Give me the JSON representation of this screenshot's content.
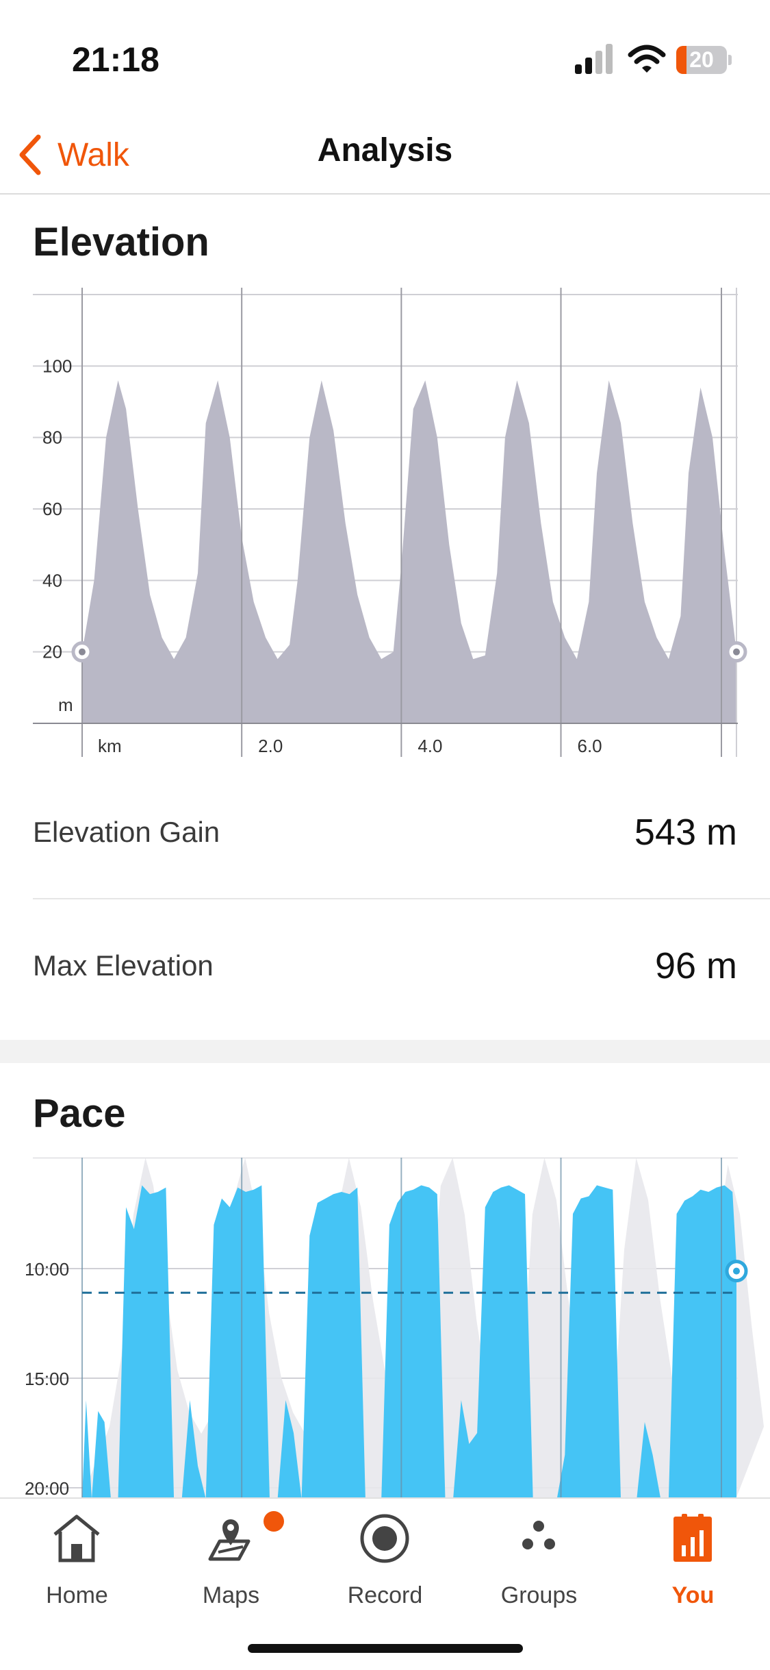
{
  "status_bar": {
    "time": "21:18",
    "battery_level": "20",
    "icons": [
      "cellular-signal-icon",
      "wifi-icon",
      "battery-icon"
    ],
    "accent": "#f0560a"
  },
  "nav": {
    "back_label": "Walk",
    "title": "Analysis"
  },
  "elevation": {
    "title": "Elevation",
    "gain_label": "Elevation Gain",
    "gain_value": "543 m",
    "max_label": "Max Elevation",
    "max_value": "96 m"
  },
  "pace": {
    "title": "Pace"
  },
  "chart_data": [
    {
      "type": "area",
      "title": "Elevation",
      "xlabel": "km",
      "ylabel": "m",
      "x_ticks": [
        "2.0",
        "4.0",
        "6.0"
      ],
      "y_ticks": [
        "100",
        "80",
        "60",
        "40",
        "20"
      ],
      "ylim": [
        0,
        120
      ],
      "xlim": [
        0,
        8.2
      ],
      "grid": true,
      "color": "#b9b8c6",
      "x": [
        0,
        0.15,
        0.3,
        0.45,
        0.55,
        0.7,
        0.85,
        1.0,
        1.15,
        1.3,
        1.45,
        1.55,
        1.7,
        1.85,
        2.0,
        2.15,
        2.3,
        2.45,
        2.6,
        2.7,
        2.85,
        3.0,
        3.15,
        3.3,
        3.45,
        3.6,
        3.75,
        3.9,
        4.0,
        4.15,
        4.3,
        4.45,
        4.6,
        4.75,
        4.9,
        5.05,
        5.2,
        5.3,
        5.45,
        5.6,
        5.75,
        5.9,
        6.05,
        6.2,
        6.35,
        6.45,
        6.6,
        6.75,
        6.9,
        7.05,
        7.2,
        7.35,
        7.5,
        7.6,
        7.75,
        7.9,
        8.05,
        8.2
      ],
      "y": [
        20,
        40,
        80,
        96,
        88,
        60,
        36,
        24,
        18,
        24,
        42,
        84,
        96,
        80,
        52,
        34,
        24,
        18,
        22,
        40,
        80,
        96,
        82,
        56,
        36,
        24,
        18,
        20,
        44,
        88,
        96,
        80,
        50,
        28,
        18,
        19,
        42,
        80,
        96,
        84,
        56,
        34,
        24,
        18,
        34,
        70,
        96,
        84,
        56,
        34,
        24,
        18,
        30,
        70,
        94,
        80,
        48,
        20
      ],
      "markers": [
        "start-marker",
        "end-marker"
      ]
    },
    {
      "type": "area",
      "title": "Pace",
      "y_ticks": [
        "10:00",
        "15:00",
        "20:00"
      ],
      "y_reversed": true,
      "ylim_minutes": [
        20.5,
        5.0
      ],
      "average_pace_minutes": 11.1,
      "grid": true,
      "color": "#45c4f5",
      "x": [
        0,
        0.05,
        0.12,
        0.2,
        0.28,
        0.36,
        0.45,
        0.55,
        0.65,
        0.75,
        0.85,
        0.95,
        1.05,
        1.15,
        1.25,
        1.35,
        1.45,
        1.55,
        1.65,
        1.75,
        1.85,
        1.95,
        2.05,
        2.15,
        2.25,
        2.35,
        2.45,
        2.55,
        2.65,
        2.75,
        2.85,
        2.95,
        3.05,
        3.15,
        3.25,
        3.35,
        3.45,
        3.55,
        3.65,
        3.75,
        3.85,
        3.95,
        4.05,
        4.15,
        4.25,
        4.35,
        4.45,
        4.55,
        4.65,
        4.75,
        4.85,
        4.95,
        5.05,
        5.15,
        5.25,
        5.35,
        5.45,
        5.55,
        5.65,
        5.75,
        5.85,
        5.95,
        6.05,
        6.15,
        6.25,
        6.35,
        6.45,
        6.55,
        6.65,
        6.75,
        6.85,
        6.95,
        7.05,
        7.15,
        7.25,
        7.35,
        7.45,
        7.55,
        7.65,
        7.75,
        7.85,
        7.95,
        8.05,
        8.15,
        8.2
      ],
      "y": [
        20.5,
        16.0,
        20.5,
        16.5,
        17.0,
        20.5,
        20.5,
        7.2,
        8.2,
        6.2,
        6.6,
        6.5,
        6.3,
        20.5,
        20.5,
        16.0,
        19.0,
        20.5,
        8.0,
        6.8,
        7.2,
        6.3,
        6.5,
        6.4,
        6.2,
        20.5,
        20.5,
        16.0,
        17.5,
        20.5,
        8.5,
        7.0,
        6.8,
        6.6,
        6.5,
        6.6,
        6.3,
        20.5,
        20.5,
        20.5,
        8.0,
        7.0,
        6.5,
        6.4,
        6.2,
        6.3,
        6.6,
        20.5,
        20.5,
        16.0,
        18.0,
        17.5,
        7.2,
        6.5,
        6.3,
        6.2,
        6.4,
        6.6,
        20.5,
        20.5,
        20.5,
        20.5,
        18.5,
        7.5,
        6.8,
        6.7,
        6.2,
        6.3,
        6.4,
        20.5,
        20.5,
        20.5,
        17.0,
        18.5,
        20.5,
        20.5,
        7.5,
        6.9,
        6.7,
        6.4,
        6.5,
        6.3,
        6.2,
        6.5,
        9.8
      ],
      "markers": [
        "end-marker"
      ]
    }
  ],
  "tabs": [
    {
      "label": "Home",
      "icon": "home-icon",
      "active": false
    },
    {
      "label": "Maps",
      "icon": "maps-icon",
      "active": false,
      "badge": true
    },
    {
      "label": "Record",
      "icon": "record-icon",
      "active": false
    },
    {
      "label": "Groups",
      "icon": "groups-icon",
      "active": false
    },
    {
      "label": "You",
      "icon": "you-icon",
      "active": true
    }
  ]
}
